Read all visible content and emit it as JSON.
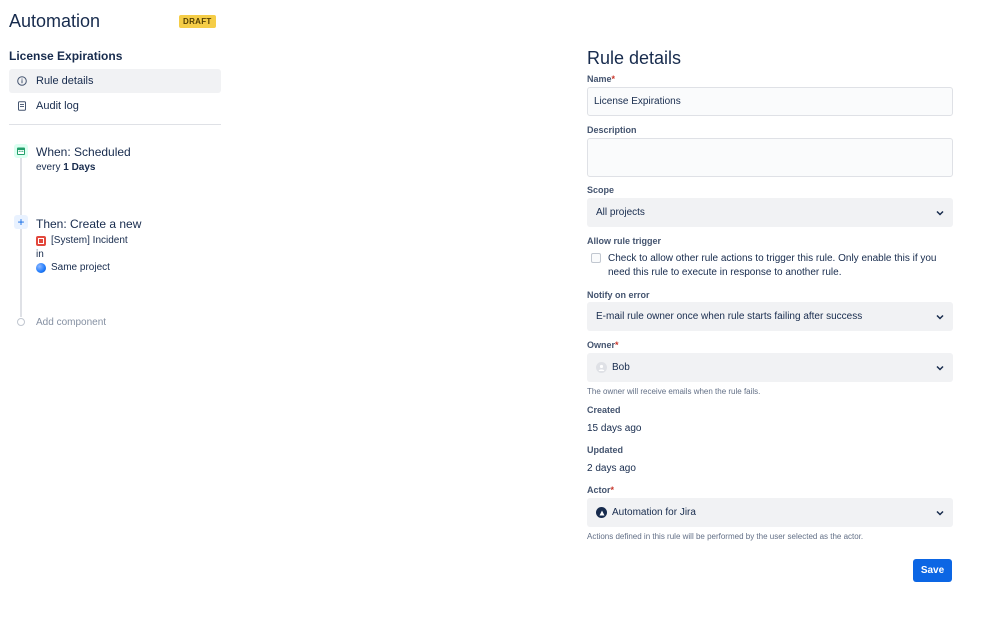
{
  "app": {
    "title": "Automation",
    "status_badge": "DRAFT"
  },
  "rule": {
    "name": "License Expirations"
  },
  "sidebar": {
    "items": [
      {
        "label": "Rule details",
        "icon": "info-icon",
        "active": true
      },
      {
        "label": "Audit log",
        "icon": "document-icon",
        "active": false
      }
    ]
  },
  "timeline": {
    "trigger": {
      "title": "When: Scheduled",
      "detail_prefix": "every ",
      "detail_value": "1 Days",
      "icon": "calendar-icon"
    },
    "action": {
      "title": "Then: Create a new",
      "issue_type": "[System] Incident",
      "connector": "in",
      "project": "Same project",
      "icon": "plus-icon"
    },
    "add_component": "Add component"
  },
  "form": {
    "title": "Rule details",
    "name": {
      "label": "Name",
      "required_mark": "*",
      "value": "License Expirations"
    },
    "description": {
      "label": "Description",
      "value": ""
    },
    "scope": {
      "label": "Scope",
      "value": "All projects"
    },
    "allow_trigger": {
      "label": "Allow rule trigger",
      "checkbox_text": "Check to allow other rule actions to trigger this rule. Only enable this if you need this rule to execute in response to another rule.",
      "checked": false
    },
    "notify": {
      "label": "Notify on error",
      "value": "E-mail rule owner once when rule starts failing after success"
    },
    "owner": {
      "label": "Owner",
      "required_mark": "*",
      "value": "Bob",
      "helper": "The owner will receive emails when the rule fails."
    },
    "created": {
      "label": "Created",
      "value": "15 days ago"
    },
    "updated": {
      "label": "Updated",
      "value": "2 days ago"
    },
    "actor": {
      "label": "Actor",
      "required_mark": "*",
      "value": "Automation for Jira",
      "helper": "Actions defined in this rule will be performed by the user selected as the actor."
    },
    "save_label": "Save"
  },
  "colors": {
    "primary": "#0c66e4",
    "draft_badge": "#f5cd47",
    "required": "#c9372c"
  }
}
